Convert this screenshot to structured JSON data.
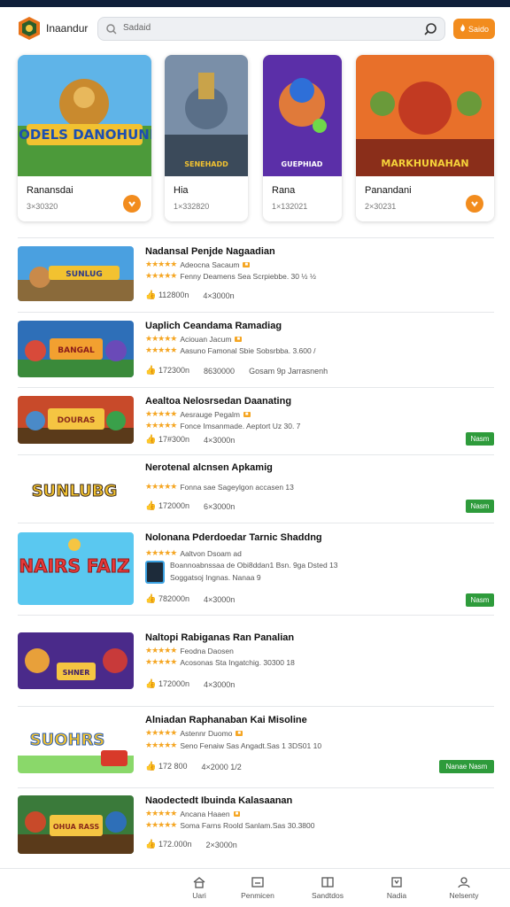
{
  "header": {
    "app_title": "Inaandur",
    "search_placeholder": "Sadaid",
    "action_button_label": "Saido"
  },
  "featured": [
    {
      "title": "Ranansdai",
      "meta": "3×30320",
      "has_button": true,
      "art_text": "NODELS DANOHUNH"
    },
    {
      "title": "Hia",
      "meta": "1×332820",
      "has_button": false,
      "art_text": "SENEHADD"
    },
    {
      "title": "Rana",
      "meta": "1×132021",
      "has_button": false,
      "art_text": "GUEPHIAD"
    },
    {
      "title": "Panandani",
      "meta": "2×30231",
      "has_button": true,
      "art_text": "MARKHUNAHAN"
    }
  ],
  "list": [
    {
      "title": "Nadansal Penjde Nagaadian",
      "sub1": "Adeocna Sacaum",
      "sub2": "Fenny Deamens Sea Scrpiebbe. 30 ½ ½",
      "likes": "112800n",
      "size": "4×3000n",
      "extra": "",
      "install": "",
      "art_text": "SUNLUG"
    },
    {
      "title": "Uaplich Ceandama Ramadiag",
      "sub1": "Aciouan Jacum",
      "sub2": "Aasuno Famonal Sbie Sobsrbba. 3.600 /",
      "likes": "172300n",
      "size": "8630000",
      "extra": "Gosam 9p Jarrasnenh",
      "install": "",
      "art_text": "BANGAL"
    },
    {
      "title": "Aealtoa Nelosrsedan Daanating",
      "sub1": "Aesrauge Pegalm",
      "sub2": "Fonce Imsanmade. Aeptort Uz 30. 7",
      "likes": "17#300n",
      "size": "4×3000n",
      "extra": "",
      "install": "Nasm",
      "art_text": "DOURAS"
    },
    {
      "title": "Nerotenal alcnsen Apkamig",
      "sub1": "",
      "sub2": "Fonna sae Sageylgon accasen 13",
      "likes": "172000n",
      "size": "6×3000n",
      "extra": "",
      "install": "Nasm",
      "art_text": "SUNLUBG"
    },
    {
      "title": "Nolonana Pderdoedar Tarnic Shaddng",
      "sub1": "Aaltvon Dsoam ad",
      "sub2": "Boannoabnssaa de Obi8ddan1 Bsn. 9ga Dsted 13",
      "likes": "782000n",
      "size": "4×3000n",
      "extra": "Soggatsoj Ingnas. Nanaa 9",
      "install": "Nasm",
      "art_text": "NAIRS FAIZ"
    },
    {
      "title": "Naltopi Rabiganas Ran Panalian",
      "sub1": "Feodna Daosen",
      "sub2": "Acosonas Sta Ingatchig. 30300 18",
      "likes": "172000n",
      "size": "4×3000n",
      "extra": "",
      "install": "",
      "art_text": "SHNER"
    },
    {
      "title": "Alniadan Raphanaban Kai Misoline",
      "sub1": "Astennr Duomo",
      "sub2": "Seno Fenaiw Sas Angadt.Sas 1 3DS01 10",
      "likes": "172 800",
      "size": "4×2000 1/2",
      "extra": "",
      "install": "Nanae Nasm",
      "art_text": "SUOHRS"
    },
    {
      "title": "Naodectedt Ibuinda Kalasaanan",
      "sub1": "Ancana Haaen",
      "sub2": "Soma Farns Roold Sanlam.Sas 30.3800",
      "likes": "172.000n",
      "size": "2×3000n",
      "extra": "",
      "install": "",
      "art_text": "OHUA RASS"
    }
  ],
  "bottom_nav": [
    {
      "label": "Uari",
      "icon": "home-icon"
    },
    {
      "label": "Penmicen",
      "icon": "window-icon"
    },
    {
      "label": "Sandtdos",
      "icon": "grid-icon"
    },
    {
      "label": "Nadia",
      "icon": "book-icon"
    },
    {
      "label": "Nelsenty",
      "icon": "person-icon"
    }
  ],
  "colors": {
    "accent": "#f28c1e",
    "install_green": "#2e9b3b",
    "star": "#f5a623",
    "top_strip": "#0f1f3a"
  }
}
